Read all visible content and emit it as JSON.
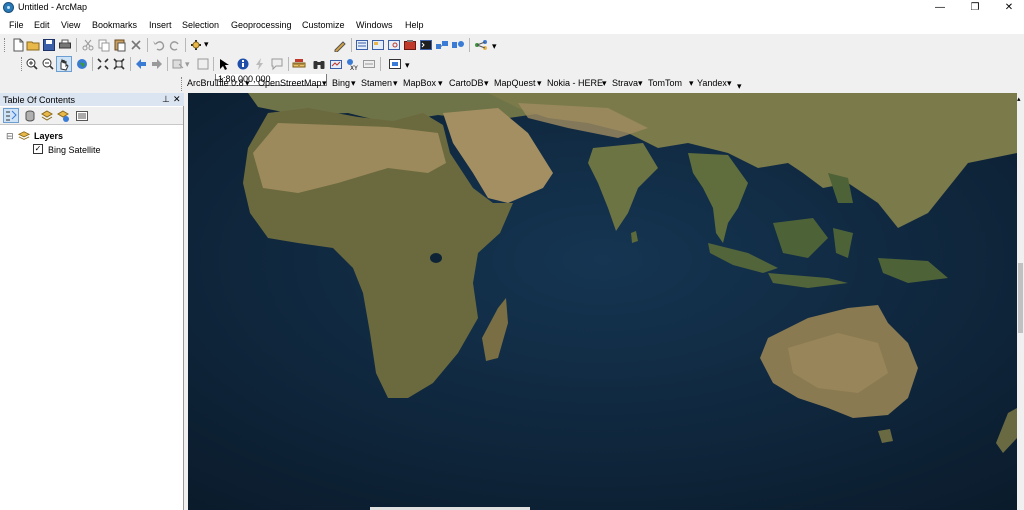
{
  "window": {
    "title": "Untitled - ArcMap",
    "minimize_glyph": "—",
    "restore_glyph": "❐",
    "close_glyph": "✕"
  },
  "menu": [
    "File",
    "Edit",
    "View",
    "Bookmarks",
    "Insert",
    "Selection",
    "Geoprocessing",
    "Customize",
    "Windows",
    "Help"
  ],
  "standard_toolbar": {
    "scale": "1:80,000,000"
  },
  "tile_toolbar": [
    "ArcBruTile 0.8",
    "OpenStreetMap",
    "Bing",
    "Stamen",
    "MapBox",
    "CartoDB",
    "MapQuest",
    "Nokia - HERE",
    "Strava",
    "TomTom",
    "Yandex"
  ],
  "toc": {
    "title": "Table Of Contents",
    "pin_glyph": "ᵩ",
    "close_glyph": "✕",
    "layers_label": "Layers",
    "expand_glyph": "⊟",
    "layer_checked_glyph": "✓",
    "layer": "Bing Satellite"
  },
  "map": {
    "basemap": "Bing Satellite",
    "ocean_color": "#0e2436",
    "land_color": "#5b6a3c",
    "desert_color": "#9c8a62"
  }
}
